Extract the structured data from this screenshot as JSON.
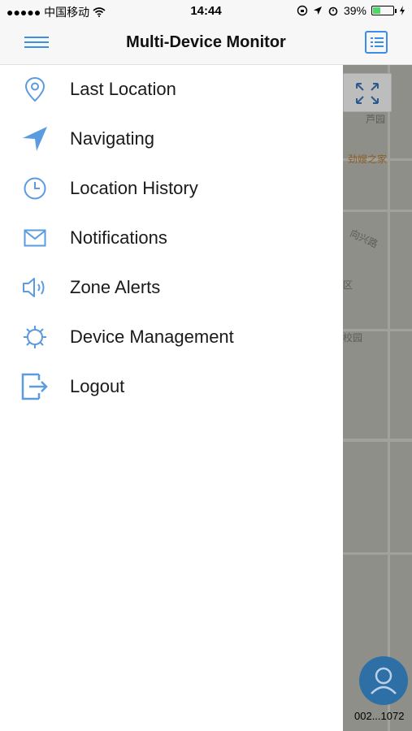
{
  "status_bar": {
    "carrier": "●●●●● 中国移动",
    "time": "14:44",
    "battery": "39%",
    "battery_level": 0.39
  },
  "nav": {
    "title": "Multi-Device Monitor",
    "menu_icon": "hamburger-icon",
    "list_icon": "list-icon"
  },
  "drawer": {
    "items": [
      {
        "label": "Last Location",
        "icon": "location-pin-icon"
      },
      {
        "label": "Navigating",
        "icon": "navigation-arrow-icon"
      },
      {
        "label": "Location History",
        "icon": "clock-icon"
      },
      {
        "label": "Notifications",
        "icon": "envelope-icon"
      },
      {
        "label": "Zone Alerts",
        "icon": "speaker-icon"
      },
      {
        "label": "Device Management",
        "icon": "gear-icon"
      },
      {
        "label": "Logout",
        "icon": "logout-icon"
      }
    ]
  },
  "map": {
    "labels": [
      "芦园",
      "劲嫂之家",
      "向兴路",
      "区",
      "校园"
    ],
    "device_label": "002...1072"
  },
  "colors": {
    "accent": "#3a8ee6",
    "icon": "#5b9be0",
    "map_overlay": "#8f8f8a"
  }
}
